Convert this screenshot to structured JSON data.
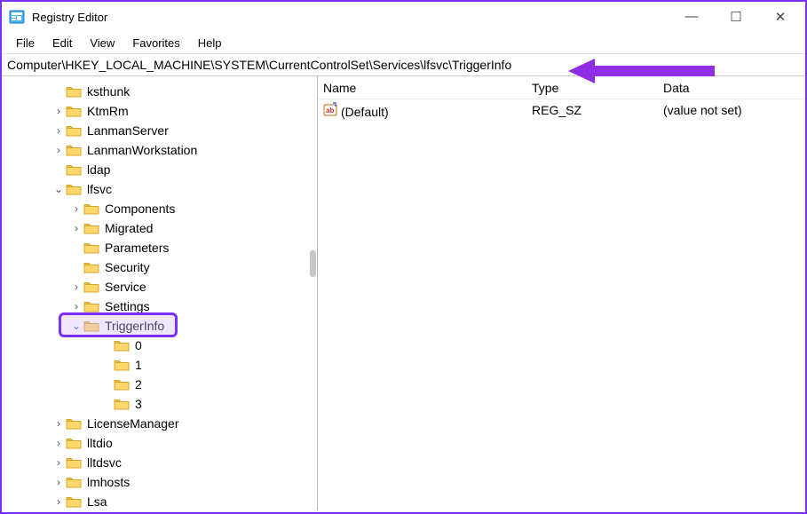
{
  "window": {
    "title": "Registry Editor"
  },
  "menu": {
    "file": "File",
    "edit": "Edit",
    "view": "View",
    "favorites": "Favorites",
    "help": "Help"
  },
  "address": {
    "value": "Computer\\HKEY_LOCAL_MACHINE\\SYSTEM\\CurrentControlSet\\Services\\lfsvc\\TriggerInfo"
  },
  "tree": {
    "items": [
      {
        "indent": 58,
        "caret": "",
        "label": "ksthunk"
      },
      {
        "indent": 58,
        "caret": "›",
        "label": "KtmRm"
      },
      {
        "indent": 58,
        "caret": "›",
        "label": "LanmanServer"
      },
      {
        "indent": 58,
        "caret": "›",
        "label": "LanmanWorkstation"
      },
      {
        "indent": 58,
        "caret": "",
        "label": "ldap"
      },
      {
        "indent": 58,
        "caret": "⌄",
        "label": "lfsvc"
      },
      {
        "indent": 78,
        "caret": "›",
        "label": "Components"
      },
      {
        "indent": 78,
        "caret": "›",
        "label": "Migrated"
      },
      {
        "indent": 78,
        "caret": "",
        "label": "Parameters"
      },
      {
        "indent": 78,
        "caret": "",
        "label": "Security"
      },
      {
        "indent": 78,
        "caret": "›",
        "label": "Service"
      },
      {
        "indent": 78,
        "caret": "›",
        "label": "Settings"
      },
      {
        "indent": 78,
        "caret": "⌄",
        "label": "TriggerInfo",
        "highlight": true
      },
      {
        "indent": 112,
        "caret": "",
        "label": "0"
      },
      {
        "indent": 112,
        "caret": "",
        "label": "1"
      },
      {
        "indent": 112,
        "caret": "",
        "label": "2"
      },
      {
        "indent": 112,
        "caret": "",
        "label": "3"
      },
      {
        "indent": 58,
        "caret": "›",
        "label": "LicenseManager"
      },
      {
        "indent": 58,
        "caret": "›",
        "label": "lltdio"
      },
      {
        "indent": 58,
        "caret": "›",
        "label": "lltdsvc"
      },
      {
        "indent": 58,
        "caret": "›",
        "label": "lmhosts"
      },
      {
        "indent": 58,
        "caret": "›",
        "label": "Lsa"
      }
    ]
  },
  "list": {
    "headers": {
      "name": "Name",
      "type": "Type",
      "data": "Data"
    },
    "rows": [
      {
        "name": "(Default)",
        "type": "REG_SZ",
        "data": "(value not set)"
      }
    ]
  }
}
